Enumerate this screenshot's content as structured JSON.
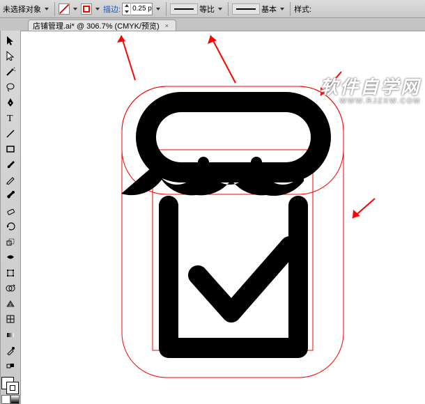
{
  "toolbar": {
    "no_selection": "未选择对象",
    "stroke_label": "描边:",
    "stroke_value": "0.25 p",
    "proportional": "等比",
    "basic": "基本",
    "style": "样式:"
  },
  "tab": {
    "title": "店铺管理.ai* @ 306.7% (CMYK/预览)",
    "close": "×"
  },
  "tool_names": {
    "selection": "selection-tool",
    "direct": "direct-selection-tool",
    "wand": "magic-wand-tool",
    "lasso": "lasso-tool",
    "pen": "pen-tool",
    "type": "type-tool",
    "line": "line-segment-tool",
    "rect": "rectangle-tool",
    "brush": "paintbrush-tool",
    "pencil": "pencil-tool",
    "blob": "blob-brush-tool",
    "eraser": "eraser-tool",
    "rotate": "rotate-tool",
    "scale": "scale-tool",
    "width": "width-tool",
    "free": "free-transform-tool",
    "shape": "shape-builder-tool",
    "perspective": "perspective-grid-tool",
    "mesh": "mesh-tool",
    "gradient": "gradient-tool",
    "eyedropper": "eyedropper-tool",
    "blend": "blend-tool",
    "symbol": "symbol-sprayer-tool",
    "graph": "column-graph-tool"
  },
  "watermark": {
    "title": "软件自学网",
    "url": "WWW.RJZXW.COM"
  }
}
